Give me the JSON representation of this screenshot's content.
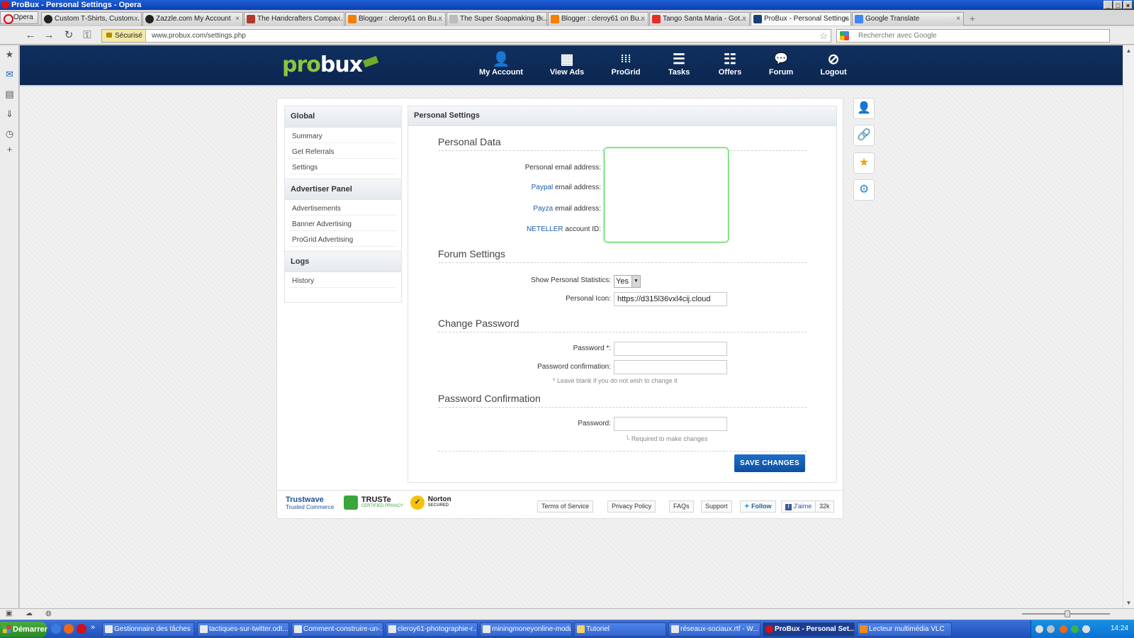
{
  "window": {
    "title": "ProBux - Personal Settings - Opera",
    "controls": [
      "_",
      "□",
      "×"
    ]
  },
  "browser": {
    "menu_label": "Opera",
    "tabs": [
      {
        "label": "Custom T-Shirts, Custom...",
        "icon_color": "#222222"
      },
      {
        "label": "Zazzle.com My Account",
        "icon_color": "#222222"
      },
      {
        "label": "The Handcrafters Compa...",
        "icon_color": "#b0392a"
      },
      {
        "label": "Blogger : cleroy61 on Bu...",
        "icon_color": "#f57d00"
      },
      {
        "label": "The Super Soapmaking B...",
        "icon_color": "#888888"
      },
      {
        "label": "Blogger : cleroy61 on Bu...",
        "icon_color": "#f57d00"
      },
      {
        "label": "Tango Santa Maria - Got...",
        "icon_color": "#e52d27"
      },
      {
        "label": "ProBux - Personal Settings",
        "icon_color": "#1a3e78"
      },
      {
        "label": "Google Translate",
        "icon_color": "#4285f4"
      }
    ],
    "tab_close": "×",
    "new_tab": "+",
    "secure_label": "Sécurisé",
    "url": "www.probux.com/settings.php",
    "search_placeholder": "Rechercher avec Google",
    "nav_icons": [
      "back-icon",
      "forward-icon",
      "reload-icon",
      "key-icon"
    ]
  },
  "site": {
    "logo_pro": "pro",
    "logo_bux": "bux",
    "nav": [
      {
        "label": "My Account",
        "icon": "user-icon",
        "glyph": "👤"
      },
      {
        "label": "View Ads",
        "icon": "grid-icon",
        "glyph": "▦"
      },
      {
        "label": "ProGrid",
        "icon": "dots-grid-icon",
        "glyph": "⁞⁞⁞"
      },
      {
        "label": "Tasks",
        "icon": "tasks-list-icon",
        "glyph": "☰"
      },
      {
        "label": "Offers",
        "icon": "offers-list-icon",
        "glyph": "☷"
      },
      {
        "label": "Forum",
        "icon": "chat-bubbles-icon",
        "glyph": "💬"
      },
      {
        "label": "Logout",
        "icon": "logout-icon",
        "glyph": "⊘"
      }
    ]
  },
  "sidebar": {
    "global": {
      "title": "Global",
      "items": [
        "Summary",
        "Get Referrals",
        "Settings"
      ]
    },
    "advertiser": {
      "title": "Advertiser Panel",
      "items": [
        "Advertisements",
        "Banner Advertising",
        "ProGrid Advertising"
      ]
    },
    "logs": {
      "title": "Logs",
      "items": [
        "History"
      ]
    }
  },
  "settings": {
    "header": "Personal Settings",
    "personal_data": {
      "title": "Personal Data",
      "personal_email_label": "Personal email address:",
      "paypal_link": "Paypal",
      "paypal_suffix": " email address:",
      "payza_link": "Payza",
      "payza_suffix": " email address:",
      "neteller_link": "NETELLER",
      "neteller_suffix": " account ID:"
    },
    "forum": {
      "title": "Forum Settings",
      "show_stats_label": "Show Personal Statistics:",
      "show_stats_value": "Yes",
      "icon_label": "Personal Icon:",
      "icon_value": "https://d315l36vxl4cij.cloud"
    },
    "change_password": {
      "title": "Change Password",
      "password_label": "Password *:",
      "confirm_label": "Password confirmation:",
      "hint": "* Leave blank if you do not wish to change it"
    },
    "confirmation": {
      "title": "Password Confirmation",
      "password_label": "Password:",
      "hint": "└ Required to make changes"
    },
    "save_label": "SAVE CHANGES"
  },
  "footer": {
    "trustwave": "Trustwave",
    "trustwave_sub": "Trusted Commerce",
    "truste": "TRUSTe",
    "truste_sub": "CERTIFIED PRIVACY",
    "norton": "Norton",
    "norton_sub": "SECURED",
    "links": [
      "Terms of Service",
      "Privacy Policy",
      "FAQs",
      "Support"
    ],
    "follow": "Follow",
    "like": "J'aime",
    "like_count": "32k"
  },
  "quicklinks": [
    "user-avatar-icon",
    "link-icon",
    "star-icon",
    "gear-icon"
  ],
  "taskbar": {
    "start": "Démarrer",
    "tasks": [
      {
        "label": "Gestionnaire des tâches ..."
      },
      {
        "label": "tactiques-sur-twitter.odt..."
      },
      {
        "label": "Comment-construire-un-..."
      },
      {
        "label": "cleroy61-photographie-r..."
      },
      {
        "label": "miningmoneyonline-modu..."
      },
      {
        "label": "Tutoriel"
      },
      {
        "label": "réseaux-sociaux.rtf - W..."
      },
      {
        "label": "ProBux - Personal Set..."
      },
      {
        "label": "Lecteur multimédia VLC"
      }
    ],
    "clock": "14:24"
  }
}
